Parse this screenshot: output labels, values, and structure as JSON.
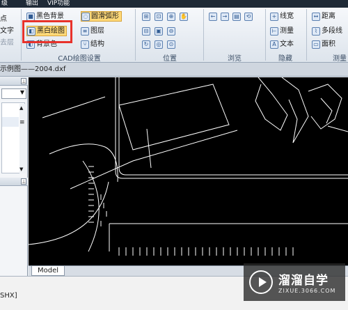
{
  "menubar": {
    "item_edit": "级",
    "item_output": "输出",
    "item_vip": "VIP功能"
  },
  "ribbon": {
    "left_cut": {
      "line1": "点",
      "line2": "文字",
      "line3": "去层"
    },
    "cad_group": {
      "item_bg": "黑色背景",
      "item_bw": "黑白绘图",
      "item_bgcolor": "背景色",
      "item_smooth": "圆滑弧形",
      "item_layers": "图层",
      "item_struct": "结构",
      "label": "CAD绘图设置"
    },
    "position_group": {
      "label": "位置"
    },
    "browse_group": {
      "label": "浏览"
    },
    "hide_group": {
      "item_linewidth": "线宽",
      "item_measure": "测量",
      "item_text": "文本",
      "label": "隐藏"
    },
    "measure_group": {
      "item_distance": "距离",
      "item_polyline": "多段线",
      "item_area": "面积",
      "label": "测量"
    }
  },
  "document": {
    "tab_title": "示例图——2004.dxf"
  },
  "model_tab": {
    "label": "Model"
  },
  "command": {
    "text": "SHX]"
  },
  "watermark": {
    "title": "溜溜自学",
    "subtitle": "ZIXUE.3066.COM"
  },
  "colors": {
    "highlight": "#ffd978",
    "redbox": "#e8322b",
    "canvas_bg": "#000000"
  }
}
